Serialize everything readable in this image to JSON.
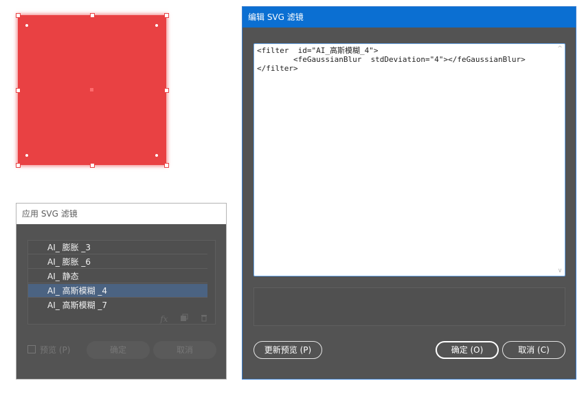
{
  "canvas": {
    "shape_color": "#e94143"
  },
  "apply_dialog": {
    "title": "应用 SVG 滤镜",
    "filters": [
      "AI_ 膨胀 _3",
      "AI_ 膨胀 _6",
      "AI_ 静态",
      "AI_ 高斯模糊 _4",
      "AI_ 高斯模糊 _7"
    ],
    "selected_filter": "AI_ 高斯模糊 _4",
    "toolbar_icons": [
      "fx-icon",
      "new-filter-icon",
      "trash-icon"
    ],
    "preview_label": "预览 (P)",
    "preview_checked": false,
    "ok_label": "确定",
    "cancel_label": "取消"
  },
  "edit_dialog": {
    "title": "编辑 SVG 滤镜",
    "code": "<filter  id=\"AI_高斯模糊_4\">\n        <feGaussianBlur  stdDeviation=\"4\"></feGaussianBlur>\n</filter>",
    "update_preview_label": "更新预览 (P)",
    "ok_label": "确定 (O)",
    "cancel_label": "取消 (C)"
  },
  "colors": {
    "title_bar_active": "#0b6fd2",
    "selection": "#4b6382",
    "dialog_bg": "#535353"
  }
}
